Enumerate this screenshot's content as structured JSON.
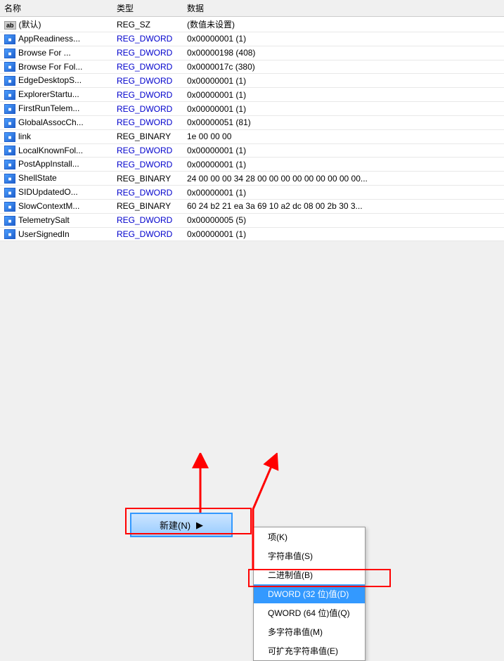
{
  "table": {
    "headers": [
      "名称",
      "类型",
      "数据"
    ],
    "rows": [
      {
        "icon": "ab",
        "name": "(默认)",
        "type": "REG_SZ",
        "data": "(数值未设置)"
      },
      {
        "icon": "reg",
        "name": "AppReadiness...",
        "type": "REG_DWORD",
        "data": "0x00000001 (1)"
      },
      {
        "icon": "reg",
        "name": "Browse For ...",
        "type": "REG_DWORD",
        "data": "0x00000198 (408)"
      },
      {
        "icon": "reg",
        "name": "Browse For Fol...",
        "type": "REG_DWORD",
        "data": "0x0000017c (380)"
      },
      {
        "icon": "reg",
        "name": "EdgeDesktopS...",
        "type": "REG_DWORD",
        "data": "0x00000001 (1)"
      },
      {
        "icon": "reg",
        "name": "ExplorerStartu...",
        "type": "REG_DWORD",
        "data": "0x00000001 (1)"
      },
      {
        "icon": "reg",
        "name": "FirstRunTelem...",
        "type": "REG_DWORD",
        "data": "0x00000001 (1)"
      },
      {
        "icon": "reg",
        "name": "GlobalAssocCh...",
        "type": "REG_DWORD",
        "data": "0x00000051 (81)"
      },
      {
        "icon": "reg",
        "name": "link",
        "type": "REG_BINARY",
        "data": "1e 00 00 00"
      },
      {
        "icon": "reg",
        "name": "LocalKnownFol...",
        "type": "REG_DWORD",
        "data": "0x00000001 (1)"
      },
      {
        "icon": "reg",
        "name": "PostAppInstall...",
        "type": "REG_DWORD",
        "data": "0x00000001 (1)"
      },
      {
        "icon": "reg",
        "name": "ShellState",
        "type": "REG_BINARY",
        "data": "24 00 00 00 34 28 00 00 00 00 00 00 00 00 00..."
      },
      {
        "icon": "reg",
        "name": "SIDUpdatedO...",
        "type": "REG_DWORD",
        "data": "0x00000001 (1)"
      },
      {
        "icon": "reg",
        "name": "SlowContextM...",
        "type": "REG_BINARY",
        "data": "60 24 b2 21 ea 3a 69 10 a2 dc 08 00 2b 30 3..."
      },
      {
        "icon": "reg",
        "name": "TelemetrySalt",
        "type": "REG_DWORD",
        "data": "0x00000005 (5)"
      },
      {
        "icon": "reg",
        "name": "UserSignedIn",
        "type": "REG_DWORD",
        "data": "0x00000001 (1)"
      }
    ]
  },
  "new_button": {
    "label": "新建(N)",
    "arrow": "▶"
  },
  "submenu": {
    "items": [
      {
        "label": "项(K)",
        "highlighted": false
      },
      {
        "label": "字符串值(S)",
        "highlighted": false
      },
      {
        "label": "二进制值(B)",
        "highlighted": false
      },
      {
        "label": "DWORD (32 位)值(D)",
        "highlighted": true
      },
      {
        "label": "QWORD (64 位)值(Q)",
        "highlighted": false
      },
      {
        "label": "多字符串值(M)",
        "highlighted": false
      },
      {
        "label": "可扩充字符串值(E)",
        "highlighted": false
      }
    ]
  }
}
